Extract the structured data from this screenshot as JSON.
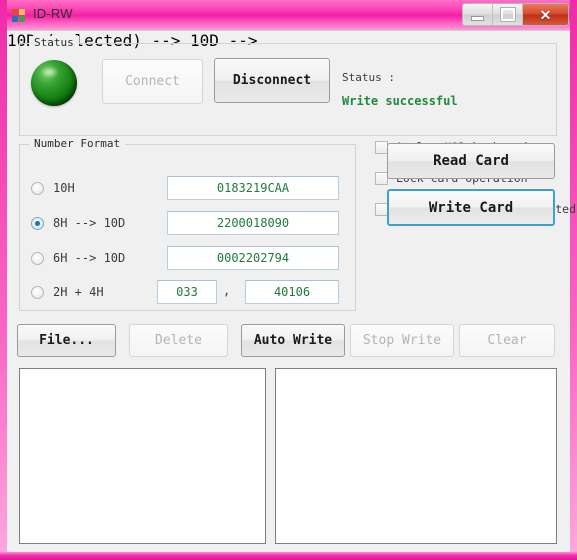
{
  "window": {
    "title": "ID-RW",
    "icon": "app-icon",
    "controls": {
      "minimize": "minimize-button",
      "maximize": "maximize-button",
      "close_glyph": "✕"
    }
  },
  "status_group": {
    "legend": "Status",
    "led_color": "#0f7a10",
    "led_state": "on",
    "connect_label": "Connect",
    "connect_enabled": false,
    "disconnect_label": "Disconnect",
    "disconnect_enabled": true,
    "status_label": "Status :",
    "status_value": "Write successful",
    "status_value_color": "#1f8a3c"
  },
  "number_format": {
    "legend": "Number Format",
    "options": [
      {
        "label": "10H",
        "selected": false,
        "value": "0183219CAA"
      },
      {
        "label": "8H --> 10D",
        "selected": true,
        "value": "2200018090"
      },
      {
        "label": "6H --> 10D",
        "selected": false,
        "value": "0002202794"
      },
      {
        "label": "2H + 4H",
        "selected": false,
        "value_a": "033",
        "separator": ",",
        "value_b": "40106"
      }
    ]
  },
  "options_panel": {
    "checkboxes": [
      {
        "label": "Analog USB keyboard",
        "checked": false
      },
      {
        "label": "Lock card operation",
        "checked": false
      },
      {
        "label": "Card number is incremented",
        "checked": false
      }
    ],
    "read_card_label": "Read Card",
    "write_card_label": "Write Card",
    "write_card_focused": true,
    "focus_color": "#3c9fd6"
  },
  "action_bar": {
    "buttons": [
      {
        "label": "File...",
        "enabled": true
      },
      {
        "label": "Delete",
        "enabled": false
      },
      {
        "label": "Auto Write",
        "enabled": true
      },
      {
        "label": "Stop Write",
        "enabled": false
      },
      {
        "label": "Clear",
        "enabled": false
      }
    ]
  },
  "output": {
    "left_list_items": [],
    "right_list_items": []
  },
  "theme": {
    "titlebar_pink": "#f41fa5",
    "client_bg": "#f0f0f0",
    "input_text_green": "#207a3c"
  }
}
